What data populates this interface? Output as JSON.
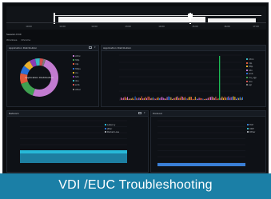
{
  "timeline": {
    "ticks": [
      "10:00",
      "11:00",
      "12:00",
      "13:00",
      "14:00",
      "15:00",
      "16:00",
      "17:00"
    ]
  },
  "header": {
    "title": "Session Drill",
    "subtitle": [
      "Windows",
      "Chrome"
    ]
  },
  "panels": {
    "app_distribution": {
      "title": "Application Distribution",
      "center_label": "Application Distribution",
      "legend": [
        "citrix",
        "http",
        "rdp",
        "https",
        "ica",
        "hdx",
        "dns",
        "smb",
        "other"
      ]
    },
    "app_timeline": {
      "title": "Application Distribution",
      "legend": [
        "citrix",
        "rdp",
        "http",
        "hdx",
        "smb",
        "ica_cgp",
        "dns",
        "sql"
      ]
    },
    "latency": {
      "title": "Network",
      "legend": [
        "Latency",
        "Jitter",
        "Packet Loss"
      ]
    },
    "protocol": {
      "title": "Protocol",
      "legend": [
        "TCP",
        "UDP",
        "Other"
      ]
    }
  },
  "colors": {
    "donut": [
      "#c27bd0",
      "#3fa050",
      "#e05a3c",
      "#2a6fd6",
      "#e9b12c",
      "#8a3bb5",
      "#39b7c3",
      "#d1504f",
      "#7c7c7c"
    ],
    "accent": "#1b7fa6",
    "spike": "#1db954",
    "latency": "#27b9d8",
    "protocol": "#3a7fd6"
  },
  "caption": "VDI /EUC Troubleshooting"
}
